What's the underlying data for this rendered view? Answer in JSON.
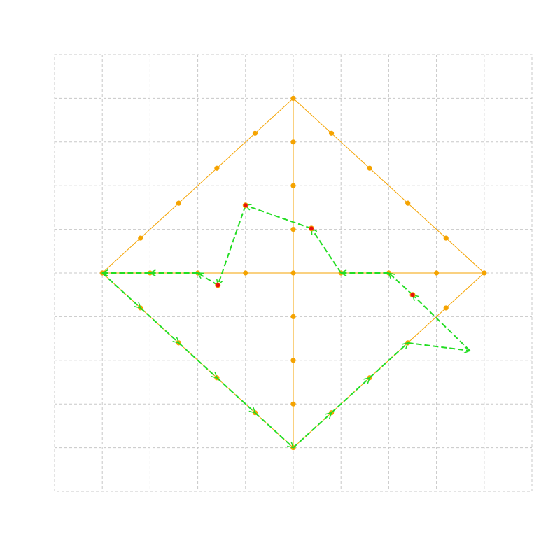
{
  "chart_data": {
    "type": "scatter",
    "title": "",
    "xlabel": "",
    "ylabel": "",
    "xlim": [
      -5,
      5
    ],
    "ylim": [
      -5,
      5
    ],
    "grid": true,
    "xticks": [
      -4,
      -3,
      -2,
      -1,
      0,
      1,
      2,
      3,
      4
    ],
    "yticks": [
      -4,
      -3,
      -2,
      -1,
      0,
      1,
      2,
      3,
      4
    ],
    "diamond_vertices": [
      [
        0,
        4
      ],
      [
        4,
        0
      ],
      [
        0,
        -4
      ],
      [
        -4,
        0
      ]
    ],
    "nodes": [
      [
        0,
        4
      ],
      [
        0.8,
        3.2
      ],
      [
        1.6,
        2.4
      ],
      [
        2.4,
        1.6
      ],
      [
        3.2,
        0.8
      ],
      [
        4,
        0
      ],
      [
        3.2,
        -0.8
      ],
      [
        2.4,
        -1.6
      ],
      [
        1.6,
        -2.4
      ],
      [
        0.8,
        -3.2
      ],
      [
        0,
        -4
      ],
      [
        -0.8,
        -3.2
      ],
      [
        -1.6,
        -2.4
      ],
      [
        -2.4,
        -1.6
      ],
      [
        -3.2,
        -0.8
      ],
      [
        -4,
        0
      ],
      [
        -3.2,
        0.8
      ],
      [
        -2.4,
        1.6
      ],
      [
        -1.6,
        2.4
      ],
      [
        -0.8,
        3.2
      ],
      [
        0,
        3
      ],
      [
        0,
        2
      ],
      [
        0,
        1
      ],
      [
        0,
        -1
      ],
      [
        0,
        -2
      ],
      [
        0,
        -3
      ],
      [
        -3,
        0
      ],
      [
        -2,
        0
      ],
      [
        -1,
        0
      ],
      [
        0,
        0
      ],
      [
        1,
        0
      ],
      [
        2,
        0
      ],
      [
        3,
        0
      ]
    ],
    "highlighted_points": [
      [
        -1,
        1.55
      ],
      [
        0.38,
        1.02
      ],
      [
        -1.58,
        -0.28
      ],
      [
        2.5,
        -0.5
      ]
    ],
    "path": [
      [
        0,
        -4
      ],
      [
        0.8,
        -3.2
      ],
      [
        1.6,
        -2.4
      ],
      [
        2.4,
        -1.6
      ],
      [
        3.7,
        -1.78
      ],
      [
        2.5,
        -0.5
      ],
      [
        2,
        0
      ],
      [
        1,
        0
      ],
      [
        0.38,
        1.02
      ],
      [
        -1,
        1.55
      ],
      [
        -1.58,
        -0.28
      ],
      [
        -2,
        0
      ],
      [
        -3,
        0
      ],
      [
        -4,
        0
      ],
      [
        -3.2,
        -0.8
      ],
      [
        -2.4,
        -1.6
      ],
      [
        -1.6,
        -2.4
      ],
      [
        -0.8,
        -3.2
      ],
      [
        0,
        -4
      ]
    ],
    "colors": {
      "diamond": "#f5a300",
      "path": "#22dd22",
      "highlight": "#e8110f",
      "grid": "#c8c8c8"
    }
  }
}
